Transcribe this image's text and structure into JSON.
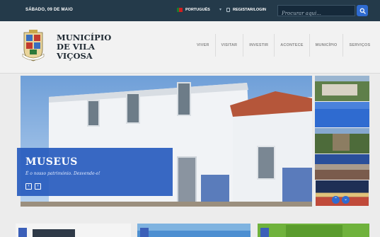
{
  "topbar": {
    "date": "SÁBADO, 09 DE MAIO",
    "language": "PORTUGUÊS",
    "separator": "▾",
    "login": "REGISTAR/LOGIN",
    "search_placeholder": "Procurar aqui..."
  },
  "header": {
    "brand_lines": [
      "MUNICÍPIO",
      "DE VILA",
      "VIÇOSA"
    ],
    "nav": [
      "VIVER",
      "VISITAR",
      "INVESTIR",
      "ACONTECE",
      "MUNICÍPIO",
      "SERVIÇOS"
    ]
  },
  "hero": {
    "title": "MUSEUS",
    "subtitle": "É o nosso património. Desvende-o!",
    "prev": "‹",
    "next": "›"
  },
  "thumbs": {
    "up": "⌃",
    "down": "⌄"
  },
  "colors": {
    "topbar": "#243a4a",
    "accent": "#2f6bd0",
    "caption": "#285cbe"
  },
  "icons": [
    "flag-icon",
    "lock-icon",
    "search-icon",
    "crest-icon",
    "chevron-left-icon",
    "chevron-right-icon",
    "chevron-up-icon",
    "chevron-down-icon"
  ]
}
